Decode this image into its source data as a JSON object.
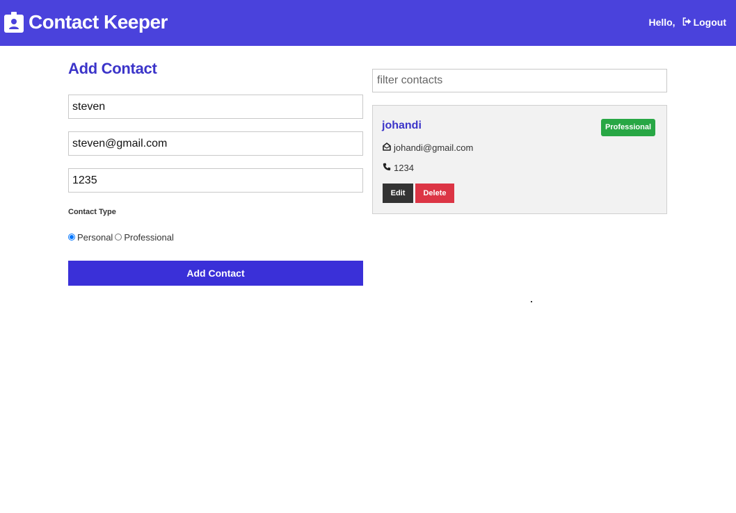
{
  "navbar": {
    "title": "Contact Keeper",
    "logo_icon": "id-badge-icon",
    "greeting": "Hello,",
    "logout_label": "Logout",
    "logout_icon": "sign-out-icon",
    "background": "#4a42dc"
  },
  "form": {
    "title": "Add Contact",
    "name_value": "steven",
    "email_value": "steven@gmail.com",
    "phone_value": "1235",
    "contact_type_label": "Contact Type",
    "type_options": [
      "Personal",
      "Professional"
    ],
    "selected_type": "Personal",
    "submit_label": "Add Contact",
    "accent": "#3a30d8"
  },
  "contacts": {
    "filter_placeholder": "filter contacts",
    "items": [
      {
        "name": "johandi",
        "type_badge": "Professional",
        "email": "johandi@gmail.com",
        "phone": "1234",
        "edit_label": "Edit",
        "delete_label": "Delete"
      }
    ],
    "colors": {
      "badge_professional": "#28a745",
      "edit_button": "#333333",
      "delete_button": "#dc3545"
    }
  }
}
